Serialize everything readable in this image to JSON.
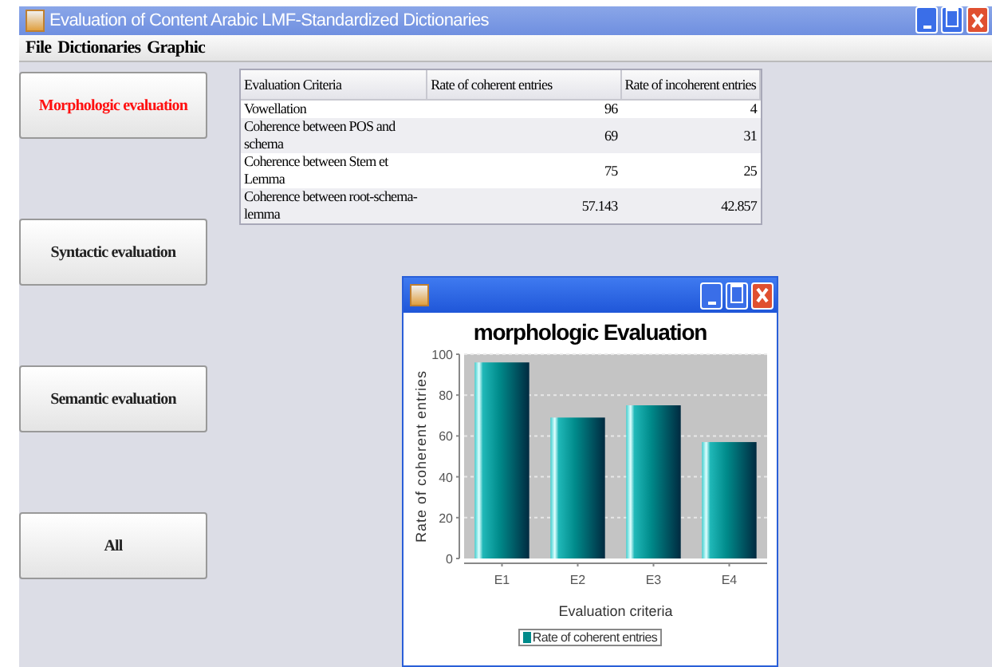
{
  "window": {
    "title": "Evaluation of Content Arabic LMF-Standardized Dictionaries"
  },
  "menu": [
    "File",
    "Dictionaries",
    "Graphic"
  ],
  "sidebar": {
    "buttons": [
      {
        "label": "Morphologic evaluation",
        "selected": true
      },
      {
        "label": "Syntactic evaluation",
        "selected": false
      },
      {
        "label": "Semantic evaluation",
        "selected": false
      },
      {
        "label": "All",
        "selected": false
      }
    ]
  },
  "table": {
    "columns": [
      "Evaluation Criteria",
      "Rate of coherent entries",
      "Rate of incoherent entries"
    ],
    "rows": [
      [
        "Vowellation",
        "96",
        "4"
      ],
      [
        "Coherence between POS and schema",
        "69",
        "31"
      ],
      [
        "Coherence between Stem et Lemma",
        "75",
        "25"
      ],
      [
        "Coherence between root-schema-lemma",
        "57.143",
        "42.857"
      ]
    ]
  },
  "chart_window": {
    "chart_data": {
      "type": "bar",
      "title": "morphologic Evaluation",
      "xlabel": "Evaluation criteria",
      "ylabel": "Rate of coherent entries",
      "categories": [
        "E1",
        "E2",
        "E3",
        "E4"
      ],
      "series": [
        {
          "name": "Rate of coherent entries",
          "color": "#008b8b",
          "values": [
            96,
            69,
            75,
            57
          ]
        }
      ],
      "grid": true,
      "ylim": [
        0,
        100
      ],
      "yticks": [
        0,
        20,
        40,
        60,
        80,
        100
      ]
    }
  }
}
